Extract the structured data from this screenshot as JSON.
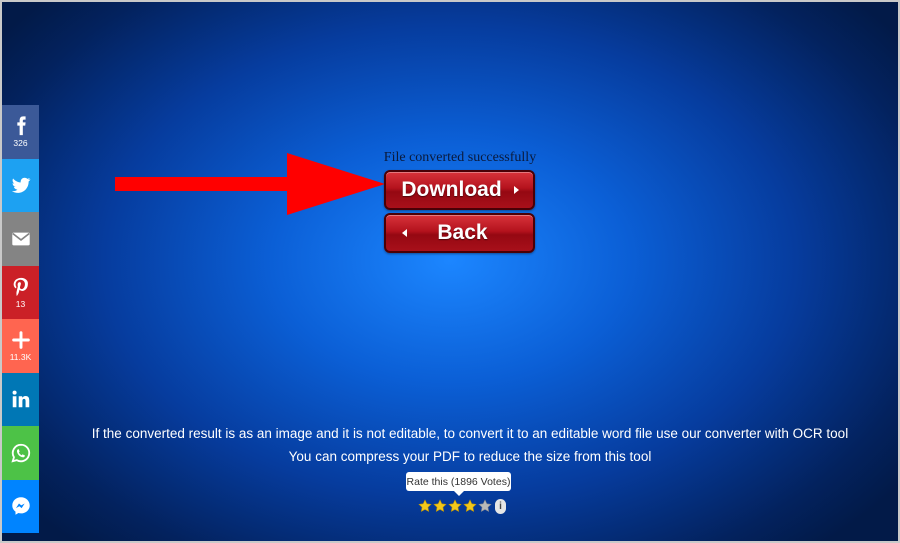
{
  "share": {
    "facebook": {
      "icon": "facebook-icon",
      "count": "326",
      "color": "#3b5998"
    },
    "twitter": {
      "icon": "twitter-icon",
      "color": "#1da1f2"
    },
    "email": {
      "icon": "email-icon",
      "color": "#848484"
    },
    "pinterest": {
      "icon": "pinterest-icon",
      "count": "13",
      "color": "#cb2027"
    },
    "addthis": {
      "icon": "plus-icon",
      "count": "11.3K",
      "color": "#ff6550"
    },
    "linkedin": {
      "icon": "linkedin-icon",
      "color": "#0077b5"
    },
    "whatsapp": {
      "icon": "whatsapp-icon",
      "color": "#4dc247"
    },
    "messenger": {
      "icon": "messenger-icon",
      "color": "#0084ff"
    }
  },
  "main": {
    "status": "File converted successfully",
    "download_label": "Download",
    "back_label": "Back",
    "button_color": "#b4121d",
    "arrow_color": "#ff0000"
  },
  "info": {
    "line1": "If the converted result is as an image and it is not editable, to convert it to an editable word file use our converter with OCR tool",
    "line2": "You can compress your PDF to reduce the size from this tool"
  },
  "rating": {
    "tooltip": "Rate this (1896 Votes)",
    "stars_filled": 4,
    "stars_total": 5,
    "info_glyph": "i"
  }
}
